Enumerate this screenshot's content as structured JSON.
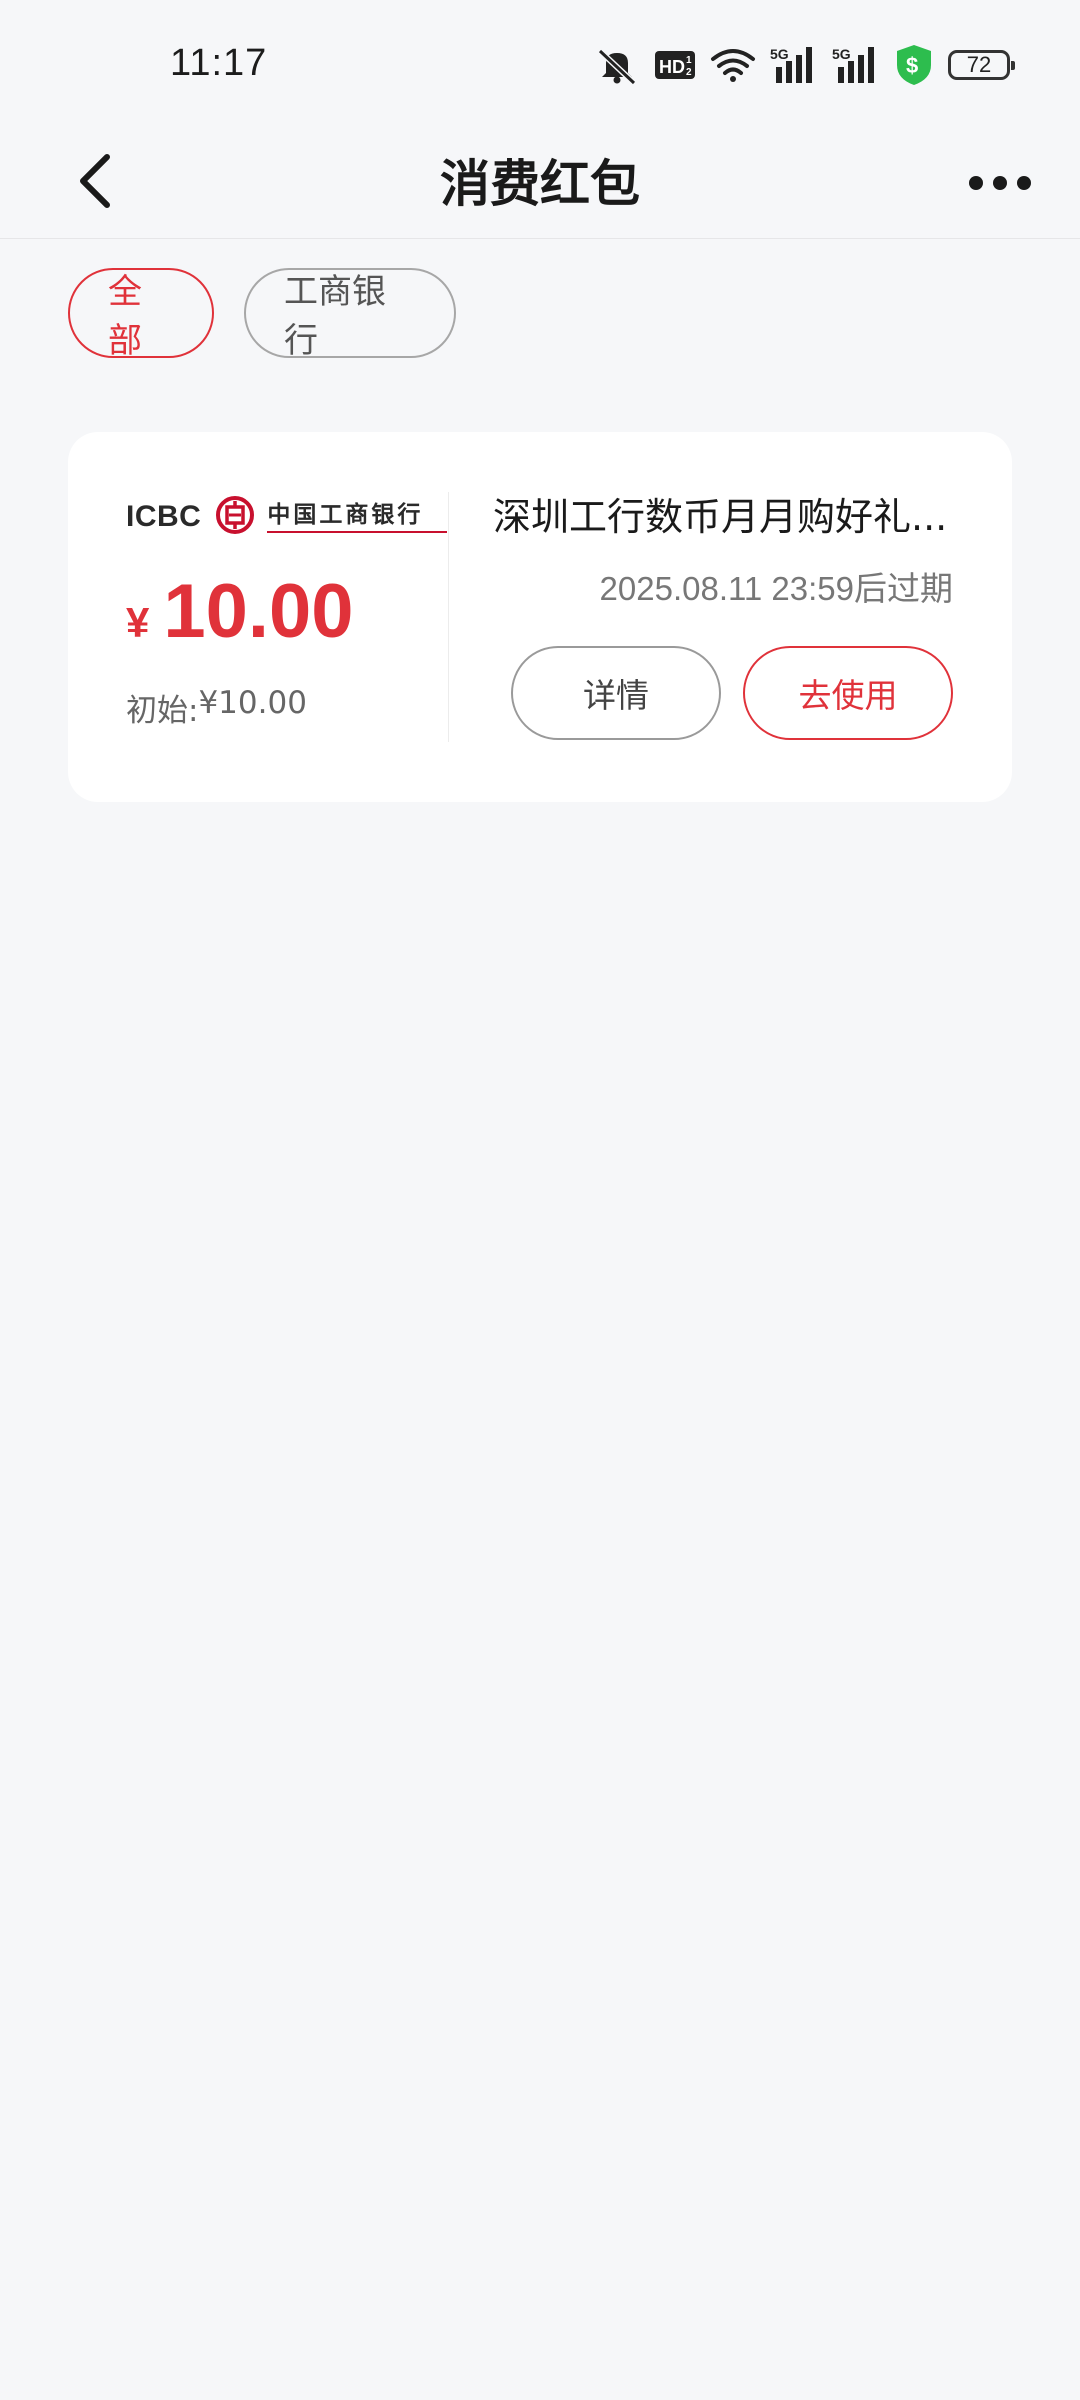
{
  "status_bar": {
    "time": "11:17",
    "battery": "72",
    "icons": [
      "bell-muted-icon",
      "hd-icon",
      "wifi-icon",
      "5g-signal-icon",
      "5g-signal-icon",
      "shield-dollar-icon",
      "battery-icon"
    ],
    "shield_color": "#2dbd4e"
  },
  "header": {
    "title": "消费红包",
    "back_icon": "back-arrow-icon",
    "more_icon": "more-dots-icon"
  },
  "filters": [
    {
      "label": "全部",
      "active": true
    },
    {
      "label": "工商银行",
      "active": false
    }
  ],
  "coupon": {
    "bank_name_en": "ICBC",
    "bank_name_cn": "中国工商银行",
    "currency_symbol": "¥",
    "amount": "10.00",
    "initial_label": "初始:",
    "initial_value": "¥10.00",
    "title": "深圳工行数币月月购好礼...",
    "expiry": "2025.08.11 23:59后过期",
    "detail_button": "详情",
    "use_button": "去使用"
  },
  "colors": {
    "accent": "#e0323a",
    "background": "#f6f7f9",
    "card": "#ffffff"
  }
}
